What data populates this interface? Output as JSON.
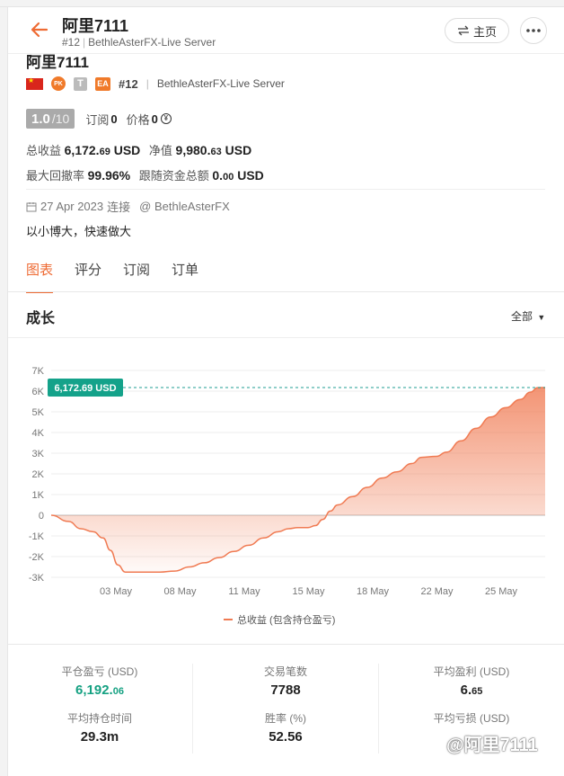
{
  "header": {
    "title": "阿里7111",
    "rank": "#12",
    "server": "BethleAsterFX-Live Server",
    "home_label": "主页"
  },
  "profile": {
    "name": "阿里7111",
    "badges": {
      "pk": "PK",
      "t": "T",
      "ea": "EA"
    },
    "rank": "#12",
    "server": "BethleAsterFX-Live Server",
    "rating": "1.0",
    "rating_den": "/10",
    "subs_label": "订阅",
    "subs_value": "0",
    "price_label": "价格",
    "price_value": "0",
    "total_profit_label": "总收益",
    "total_profit_main": "6,172.",
    "total_profit_dec": "69",
    "currency": "USD",
    "equity_label": "净值",
    "equity_main": "9,980.",
    "equity_dec": "63",
    "drawdown_label": "最大回撤率",
    "drawdown_value": "99.96%",
    "follow_label": "跟随资金总额",
    "follow_main": "0.",
    "follow_dec": "00",
    "joined_date": "27 Apr 2023",
    "joined_label": "连接",
    "broker_handle": "@ BethleAsterFX",
    "motto": "以小博大，快速做大"
  },
  "tabs": [
    "图表",
    "评分",
    "订阅",
    "订单"
  ],
  "active_tab": 0,
  "growth": {
    "title": "成长",
    "range": "全部"
  },
  "chart_data": {
    "type": "area",
    "title": "",
    "ylabel": "",
    "xlabel": "",
    "ylim": [
      -3000,
      7000
    ],
    "y_ticks": [
      "7K",
      "6K",
      "5K",
      "4K",
      "3K",
      "2K",
      "1K",
      "0",
      "-1K",
      "-2K",
      "-3K"
    ],
    "x_ticks": [
      "03 May",
      "08 May",
      "11 May",
      "15 May",
      "18 May",
      "22 May",
      "25 May"
    ],
    "last_value_label": "6,172.69 USD",
    "series": [
      {
        "name": "总收益 (包含持仓盈亏)",
        "color": "#f07a52",
        "points": [
          [
            0,
            0
          ],
          [
            0.035,
            -300
          ],
          [
            0.06,
            -650
          ],
          [
            0.085,
            -800
          ],
          [
            0.105,
            -1100
          ],
          [
            0.12,
            -1700
          ],
          [
            0.135,
            -2400
          ],
          [
            0.15,
            -2750
          ],
          [
            0.18,
            -2750
          ],
          [
            0.22,
            -2750
          ],
          [
            0.25,
            -2700
          ],
          [
            0.28,
            -2500
          ],
          [
            0.31,
            -2300
          ],
          [
            0.34,
            -2050
          ],
          [
            0.37,
            -1750
          ],
          [
            0.4,
            -1450
          ],
          [
            0.43,
            -1100
          ],
          [
            0.46,
            -800
          ],
          [
            0.48,
            -650
          ],
          [
            0.5,
            -600
          ],
          [
            0.52,
            -600
          ],
          [
            0.535,
            -500
          ],
          [
            0.55,
            -200
          ],
          [
            0.565,
            200
          ],
          [
            0.58,
            500
          ],
          [
            0.61,
            900
          ],
          [
            0.64,
            1350
          ],
          [
            0.67,
            1800
          ],
          [
            0.7,
            2100
          ],
          [
            0.73,
            2500
          ],
          [
            0.75,
            2800
          ],
          [
            0.78,
            2850
          ],
          [
            0.8,
            3050
          ],
          [
            0.83,
            3600
          ],
          [
            0.86,
            4200
          ],
          [
            0.89,
            4750
          ],
          [
            0.92,
            5200
          ],
          [
            0.95,
            5600
          ],
          [
            0.97,
            5950
          ],
          [
            0.985,
            6170
          ],
          [
            1.0,
            6172.69
          ]
        ]
      }
    ]
  },
  "metrics": [
    {
      "label": "平仓盈亏 (USD)",
      "main": "6,192.",
      "dec": "06",
      "green": true
    },
    {
      "label": "交易笔数",
      "main": "7788",
      "dec": "",
      "green": false
    },
    {
      "label": "平均盈利 (USD)",
      "main": "6.",
      "dec": "65",
      "green": false
    },
    {
      "label": "平均持仓时间",
      "main": "29.3m",
      "dec": "",
      "green": false
    },
    {
      "label": "胜率 (%)",
      "main": "52.56",
      "dec": "",
      "green": false
    },
    {
      "label": "平均亏损 (USD)",
      "main": "",
      "dec": "",
      "green": false
    }
  ],
  "watermark": "@阿里7111"
}
